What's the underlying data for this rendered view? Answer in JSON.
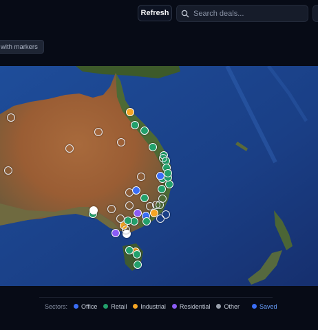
{
  "toolbar": {
    "refresh_label": "Refresh",
    "search_placeholder": "Search deals..."
  },
  "filter_chip": {
    "label": "with markers"
  },
  "map": {
    "markers": [
      {
        "sector": "other"
      },
      {
        "sector": "other"
      },
      {
        "sector": "other"
      },
      {
        "sector": "other"
      },
      {
        "sector": "other"
      },
      {
        "sector": "other"
      },
      {
        "sector": "other"
      },
      {
        "sector": "other"
      },
      {
        "sector": "industrial"
      },
      {
        "sector": "retail"
      },
      {
        "sector": "retail"
      },
      {
        "sector": "retail"
      },
      {
        "sector": "retail"
      },
      {
        "sector": "retail"
      },
      {
        "sector": "retail"
      },
      {
        "sector": "retail"
      },
      {
        "sector": "retail"
      },
      {
        "sector": "office"
      },
      {
        "sector": "retail"
      },
      {
        "sector": "retail"
      },
      {
        "sector": "other"
      },
      {
        "sector": "other"
      },
      {
        "sector": "other"
      },
      {
        "sector": "other"
      },
      {
        "sector": "retail"
      },
      {
        "sector": "office"
      },
      {
        "sector": "industrial"
      },
      {
        "sector": "residential"
      },
      {
        "sector": "retail"
      },
      {
        "sector": "retail"
      },
      {
        "sector": "residential"
      },
      {
        "sector": "industrial"
      },
      {
        "sector": "retail"
      },
      {
        "sector": "other"
      },
      {
        "sector": "white"
      },
      {
        "sector": "white"
      },
      {
        "sector": "retail"
      },
      {
        "sector": "industrial"
      },
      {
        "sector": "retail"
      },
      {
        "sector": "retail"
      },
      {
        "sector": "other"
      },
      {
        "sector": "other"
      },
      {
        "sector": "retail"
      },
      {
        "sector": "office"
      },
      {
        "sector": "retail"
      },
      {
        "sector": "other"
      },
      {
        "sector": "other"
      },
      {
        "sector": "other"
      }
    ]
  },
  "legend": {
    "title": "Sectors:",
    "items": [
      {
        "label": "Office",
        "color": "#3b6ef5"
      },
      {
        "label": "Retail",
        "color": "#22a06b"
      },
      {
        "label": "Industrial",
        "color": "#f5a524"
      },
      {
        "label": "Residential",
        "color": "#8b5cf6"
      },
      {
        "label": "Other",
        "color": "#9aa1ad"
      }
    ],
    "saved_label": "Saved",
    "saved_color": "#3b6ef5"
  }
}
